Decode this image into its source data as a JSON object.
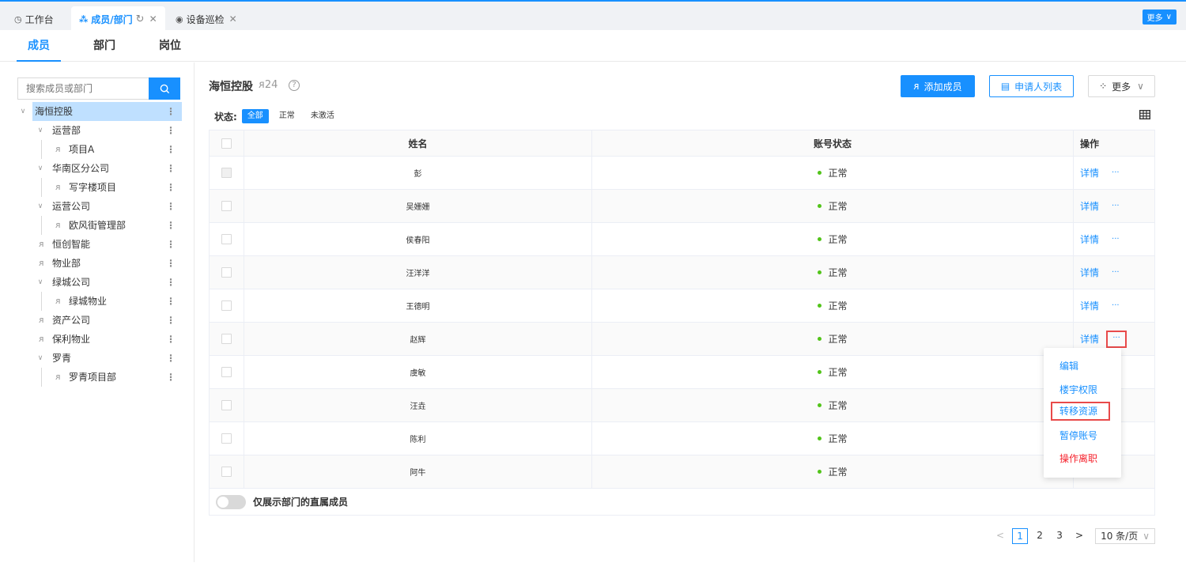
{
  "top_tabs": [
    {
      "label": "工作台",
      "icon": "dashboard-icon"
    },
    {
      "label": "成员/部门",
      "icon": "org-icon"
    },
    {
      "label": "设备巡检",
      "icon": "signal-icon"
    }
  ],
  "top_more": "更多",
  "sub_tabs": [
    "成员",
    "部门",
    "岗位"
  ],
  "search": {
    "placeholder": "搜索成员或部门"
  },
  "tree": [
    {
      "label": "海恒控股",
      "level": 0,
      "type": "folder",
      "selected": true
    },
    {
      "label": "运营部",
      "level": 1,
      "type": "folder"
    },
    {
      "label": "项目A",
      "level": 2,
      "type": "group"
    },
    {
      "label": "华南区分公司",
      "level": 1,
      "type": "folder"
    },
    {
      "label": "写字楼项目",
      "level": 2,
      "type": "group"
    },
    {
      "label": "运营公司",
      "level": 1,
      "type": "folder"
    },
    {
      "label": "欧风街管理部",
      "level": 2,
      "type": "group"
    },
    {
      "label": "恒创智能",
      "level": 1,
      "type": "group"
    },
    {
      "label": "物业部",
      "level": 1,
      "type": "group"
    },
    {
      "label": "绿城公司",
      "level": 1,
      "type": "folder"
    },
    {
      "label": "绿城物业",
      "level": 2,
      "type": "group"
    },
    {
      "label": "资产公司",
      "level": 1,
      "type": "group"
    },
    {
      "label": "保利物业",
      "level": 1,
      "type": "group"
    },
    {
      "label": "罗青",
      "level": 1,
      "type": "folder"
    },
    {
      "label": "罗青项目部",
      "level": 2,
      "type": "group"
    }
  ],
  "main": {
    "org_name": "海恒控股",
    "member_count": "24",
    "buttons": {
      "add_member": "添加成员",
      "applicants": "申请人列表",
      "more": "更多"
    },
    "status_label": "状态:",
    "status_filters": [
      "全部",
      "正常",
      "未激活"
    ]
  },
  "table": {
    "headers": {
      "name": "姓名",
      "status": "账号状态",
      "ops": "操作"
    },
    "rows": [
      {
        "name": "彭",
        "status": "正常"
      },
      {
        "name": "吴姗姗",
        "status": "正常"
      },
      {
        "name": "侯春阳",
        "status": "正常"
      },
      {
        "name": "汪洋洋",
        "status": "正常"
      },
      {
        "name": "王德明",
        "status": "正常"
      },
      {
        "name": "赵辉",
        "status": "正常"
      },
      {
        "name": "虞敏",
        "status": "正常"
      },
      {
        "name": "汪垚",
        "status": "正常"
      },
      {
        "name": "陈利",
        "status": "正常"
      },
      {
        "name": "阿牛",
        "status": "正常"
      }
    ],
    "detail_label": "详情",
    "more_label": "···"
  },
  "footer_toggle_label": "仅展示部门的直属成员",
  "pagination": {
    "pages": [
      "1",
      "2",
      "3"
    ],
    "current": "1",
    "page_size": "10 条/页"
  },
  "dropdown_menu": [
    {
      "label": "编辑"
    },
    {
      "label": "楼宇权限"
    },
    {
      "label": "转移资源"
    },
    {
      "label": "暂停账号"
    },
    {
      "label": "操作离职"
    }
  ],
  "colors": {
    "primary": "#1890ff",
    "success": "#52c41a",
    "danger": "#f5222d",
    "highlight_box": "#e84a4a"
  }
}
